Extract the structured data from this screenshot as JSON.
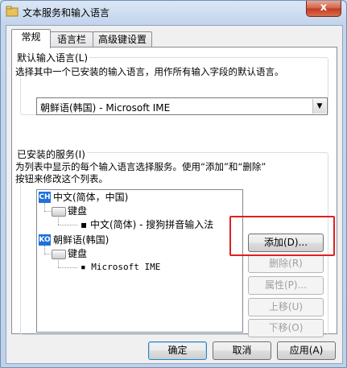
{
  "window": {
    "title": "文本服务和输入语言",
    "close_label": "x"
  },
  "tabs": [
    {
      "label": "常规"
    },
    {
      "label": "语言栏"
    },
    {
      "label": "高级键设置"
    }
  ],
  "default_language": {
    "group_label": "默认输入语言(L)",
    "description": "选择其中一个已安装的输入语言，用作所有输入字段的默认语言。",
    "selected": "朝鲜语(韩国) - Microsoft IME",
    "arrow_icon": "▼"
  },
  "installed_services": {
    "group_label": "已安装的服务(I)",
    "description_line1": "为列表中显示的每个输入语言选择服务。使用“添加”和“删除”",
    "description_line2": "按钮来修改这个列表。",
    "tree": {
      "lang1": {
        "badge": "CH",
        "label": "中文(简体，中国)"
      },
      "lang1_category": "键盘",
      "lang1_service": "中文(简体) - 搜狗拼音输入法",
      "lang2": {
        "badge": "KO",
        "label": "朝鲜语(韩国)"
      },
      "lang2_category": "键盘",
      "lang2_service": "Microsoft IME"
    },
    "buttons": {
      "add": "添加(D)...",
      "remove": "删除(R)",
      "properties": "属性(P)...",
      "move_up": "上移(U)",
      "move_down": "下移(O)"
    }
  },
  "footer": {
    "ok": "确定",
    "cancel": "取消",
    "apply": "应用(A)"
  },
  "colors": {
    "highlight_box": "#e02020",
    "flag_blue": "#1e72d8"
  }
}
